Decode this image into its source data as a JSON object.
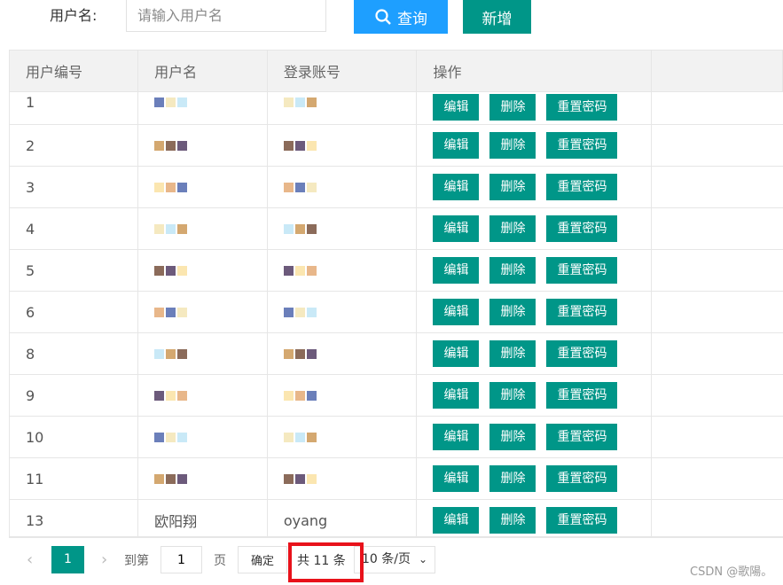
{
  "search": {
    "label": "用户名:",
    "placeholder": "请输入用户名",
    "query_label": "查询",
    "add_label": "新增"
  },
  "table": {
    "headers": [
      "用户编号",
      "用户名",
      "登录账号",
      "操作"
    ],
    "rows": [
      {
        "id": "1",
        "username": "",
        "account": ""
      },
      {
        "id": "2",
        "username": "",
        "account": ""
      },
      {
        "id": "3",
        "username": "",
        "account": ""
      },
      {
        "id": "4",
        "username": "",
        "account": ""
      },
      {
        "id": "5",
        "username": "",
        "account": ""
      },
      {
        "id": "6",
        "username": "",
        "account": ""
      },
      {
        "id": "8",
        "username": "",
        "account": ""
      },
      {
        "id": "9",
        "username": "",
        "account": ""
      },
      {
        "id": "10",
        "username": "",
        "account": ""
      },
      {
        "id": "11",
        "username": "",
        "account": ""
      },
      {
        "id": "13",
        "username": "欧阳翔",
        "account": "oyang"
      }
    ],
    "actions": {
      "edit": "编辑",
      "delete": "删除",
      "reset": "重置密码"
    }
  },
  "pagination": {
    "current": "1",
    "goto_label": "到第",
    "goto_value": "1",
    "page_label": "页",
    "confirm": "确定",
    "total": "共 11 条",
    "page_size": "10 条/页"
  },
  "watermark": "CSDN @歌陽。",
  "colors": {
    "primary": "#009688",
    "query": "#1e9fff",
    "highlight": "#e8121b"
  }
}
